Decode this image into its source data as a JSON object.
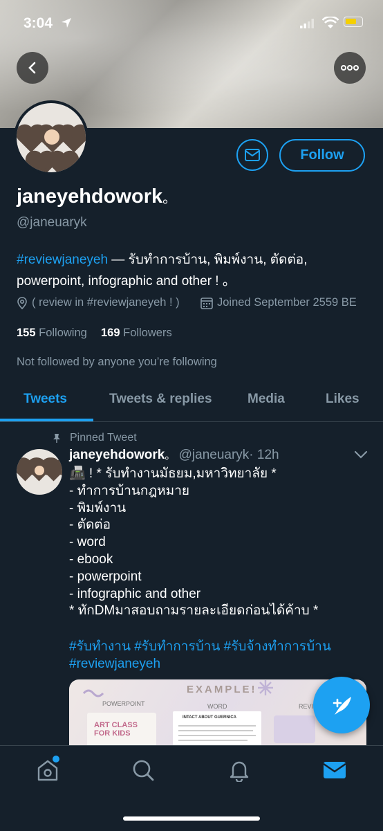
{
  "status_bar": {
    "time": "3:04"
  },
  "profile": {
    "display_name": "janeyehdowork",
    "name_suffix": "。",
    "handle": "@janeuaryk",
    "follow_label": "Follow",
    "bio": {
      "hashtag": "#reviewjaneyeh",
      "line1_rest": " — รับทำการบ้าน, พิมพ์งาน, ตัดต่อ,",
      "line2": "powerpoint, infographic and other ! 。"
    },
    "location": "( review in #reviewjaneyeh ! )",
    "joined": "Joined September 2559 BE",
    "following_count": "155",
    "following_label": "Following",
    "followers_count": "169",
    "followers_label": "Followers",
    "not_followed_note": "Not followed by anyone you’re following"
  },
  "tabs": [
    {
      "label": "Tweets",
      "active": true
    },
    {
      "label": "Tweets & replies"
    },
    {
      "label": "Media"
    },
    {
      "label": "Likes"
    }
  ],
  "pinned_tweet": {
    "pinned_label": "Pinned Tweet",
    "author_name": "janeyehdowork",
    "author_suffix": "。",
    "author_handle": "@janeuaryk",
    "time": "· 12h",
    "lines": [
      "📠 ! * รับทำงานมัธยม,มหาวิทยาลัย *",
      "- ทำการบ้านกฎหมาย",
      "- พิมพ์งาน",
      "- ตัดต่อ",
      "- word",
      "- ebook",
      "- powerpoint",
      "- infographic and other",
      "* ทักDMมาสอบถามรายละเอียดก่อนได้ค้าบ *"
    ],
    "hashtags_line1": "#รับทำงาน #รับทำการบ้าน #รับจ้างทำการบ้าน",
    "hashtags_line2": "#reviewjaneyeh",
    "media": {
      "title": "EXAMPLE!",
      "label_powerpoint": "POWERPOINT",
      "label_word": "WORD",
      "label_review": "REVI",
      "art_class": "ART CLASS\nFOR KIDS",
      "doc_title": "INTACT ABOUT GUERNICA"
    }
  },
  "colors": {
    "accent": "#1da1f2",
    "background": "#15202b",
    "muted": "#8899a6"
  }
}
